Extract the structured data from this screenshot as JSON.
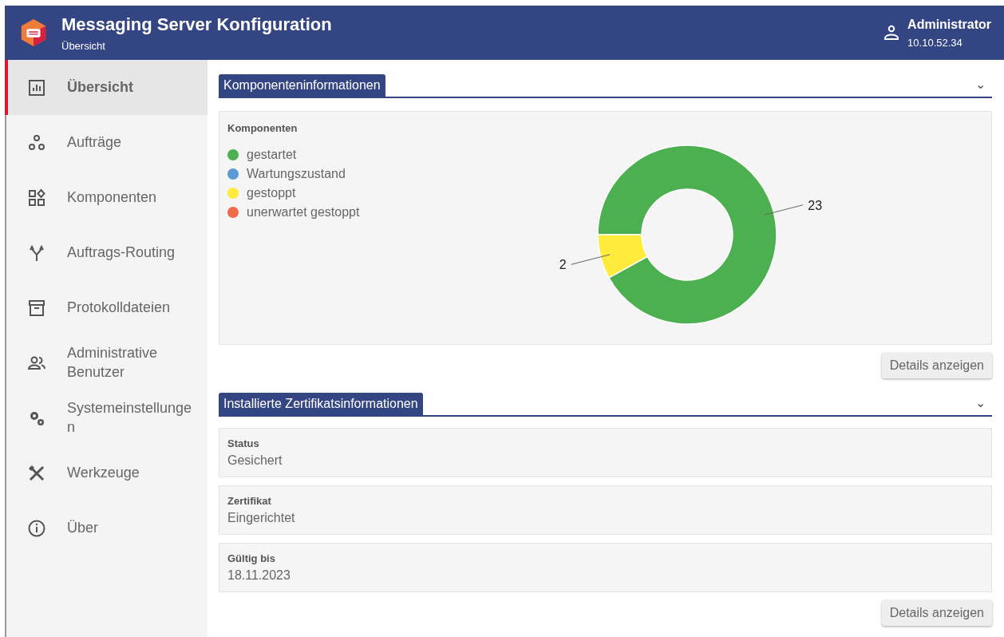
{
  "header": {
    "title": "Messaging Server Konfiguration",
    "subtitle": "Übersicht",
    "user": "Administrator",
    "address": "10.10.52.34"
  },
  "sidebar": {
    "items": [
      {
        "label": "Übersicht",
        "selected": true
      },
      {
        "label": "Aufträge",
        "selected": false
      },
      {
        "label": "Komponenten",
        "selected": false
      },
      {
        "label": "Auftrags-Routing",
        "selected": false
      },
      {
        "label": "Protokolldateien",
        "selected": false
      },
      {
        "label": "Administrative Benutzer",
        "selected": false
      },
      {
        "label": "Systemeinstellunge n",
        "selected": false
      },
      {
        "label": "Werkzeuge",
        "selected": false
      },
      {
        "label": "Über",
        "selected": false
      }
    ]
  },
  "sections": [
    {
      "title": "Komponenteninformationen",
      "expand_icon": "⌄",
      "kind": "chart",
      "legend": [
        {
          "color": "#4caf50"
        },
        {
          "color": "#5b9bd5"
        },
        {
          "color": "#ffeb3b"
        },
        {
          "color": "#ef6c4a"
        }
      ],
      "chart_data": {
        "type": "donut",
        "categories": [
          "gestartet",
          "Wartungszustand",
          "gestoppt",
          "unerwartet gestoppt"
        ],
        "series": [
          {
            "name": "Komponenten",
            "values": [
              23,
              0,
              2,
              0
            ]
          }
        ],
        "data_labels": true
      },
      "button": "Details anzeigen"
    },
    {
      "title": "Installierte Zertifikatsinformationen",
      "expand_icon": "⌄",
      "kind": "fields",
      "fields": [
        {
          "label": "Status",
          "value": "Gesichert"
        },
        {
          "label": "Zertifikat",
          "value": "Eingerichtet"
        },
        {
          "label": "Gültig bis",
          "value": "18.11.2023"
        }
      ],
      "button": "Details anzeigen"
    }
  ]
}
